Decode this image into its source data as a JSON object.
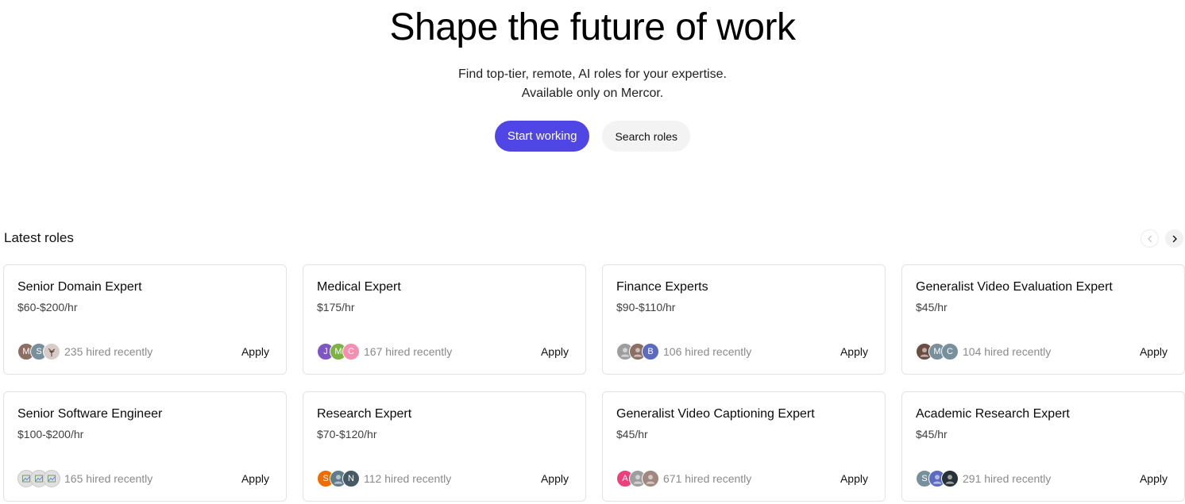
{
  "hero": {
    "title": "Shape the future of work",
    "subtitle_line1": "Find top-tier, remote, AI roles for your expertise.",
    "subtitle_line2": "Available only on Mercor.",
    "primary_cta": "Start working",
    "secondary_cta": "Search roles"
  },
  "section": {
    "title": "Latest roles"
  },
  "colors": {
    "accent": "#4f46e5",
    "secondary_button_bg": "#f3f3f4",
    "card_border": "#e3e3e3",
    "muted_text": "#8a8a8a"
  },
  "roles": [
    {
      "title": "Senior Domain Expert",
      "rate": "$60-$200/hr",
      "hired": "235 hired recently",
      "apply": "Apply",
      "avatars": [
        {
          "initial": "M",
          "color": "#8d6e63"
        },
        {
          "initial": "S",
          "color": "#78909c"
        },
        {
          "initial": "",
          "color": "#d7ccc8",
          "icon": "tree-photo-icon"
        }
      ]
    },
    {
      "title": "Medical Expert",
      "rate": "$175/hr",
      "hired": "167 hired recently",
      "apply": "Apply",
      "avatars": [
        {
          "initial": "J",
          "color": "#7e57c2"
        },
        {
          "initial": "M",
          "color": "#7cb342"
        },
        {
          "initial": "C",
          "color": "#f48fb1"
        }
      ]
    },
    {
      "title": "Finance Experts",
      "rate": "$90-$110/hr",
      "hired": "106 hired recently",
      "apply": "Apply",
      "avatars": [
        {
          "initial": "",
          "color": "#9e9e9e",
          "icon": "photo-avatar-icon"
        },
        {
          "initial": "",
          "color": "#8d6e63",
          "icon": "photo-avatar-icon"
        },
        {
          "initial": "B",
          "color": "#5c6bc0"
        }
      ]
    },
    {
      "title": "Generalist Video Evaluation Expert",
      "rate": "$45/hr",
      "hired": "104 hired recently",
      "apply": "Apply",
      "avatars": [
        {
          "initial": "",
          "color": "#6d4c41",
          "icon": "photo-avatar-icon"
        },
        {
          "initial": "M",
          "color": "#78909c"
        },
        {
          "initial": "C",
          "color": "#78909c"
        }
      ]
    },
    {
      "title": "Senior Software Engineer",
      "rate": "$100-$200/hr",
      "hired": "165 hired recently",
      "apply": "Apply",
      "avatars": [
        {
          "initial": "",
          "color": "#e0e0e0",
          "icon": "broken-image-icon"
        },
        {
          "initial": "",
          "color": "#e0e0e0",
          "icon": "broken-image-icon"
        },
        {
          "initial": "",
          "color": "#e0e0e0",
          "icon": "broken-image-icon"
        }
      ]
    },
    {
      "title": "Research Expert",
      "rate": "$70-$120/hr",
      "hired": "112 hired recently",
      "apply": "Apply",
      "avatars": [
        {
          "initial": "S",
          "color": "#ef6c00"
        },
        {
          "initial": "",
          "color": "#607d8b",
          "icon": "photo-avatar-icon"
        },
        {
          "initial": "N",
          "color": "#455a64"
        }
      ]
    },
    {
      "title": "Generalist Video Captioning Expert",
      "rate": "$45/hr",
      "hired": "671 hired recently",
      "apply": "Apply",
      "avatars": [
        {
          "initial": "A",
          "color": "#ec407a"
        },
        {
          "initial": "",
          "color": "#9e9e9e",
          "icon": "photo-avatar-icon"
        },
        {
          "initial": "",
          "color": "#a1887f",
          "icon": "photo-avatar-icon"
        }
      ]
    },
    {
      "title": "Academic Research Expert",
      "rate": "$45/hr",
      "hired": "291 hired recently",
      "apply": "Apply",
      "avatars": [
        {
          "initial": "S",
          "color": "#78909c"
        },
        {
          "initial": "",
          "color": "#5c6bc0",
          "icon": "photo-avatar-icon"
        },
        {
          "initial": "",
          "color": "#263238",
          "icon": "photo-avatar-icon"
        }
      ]
    }
  ]
}
